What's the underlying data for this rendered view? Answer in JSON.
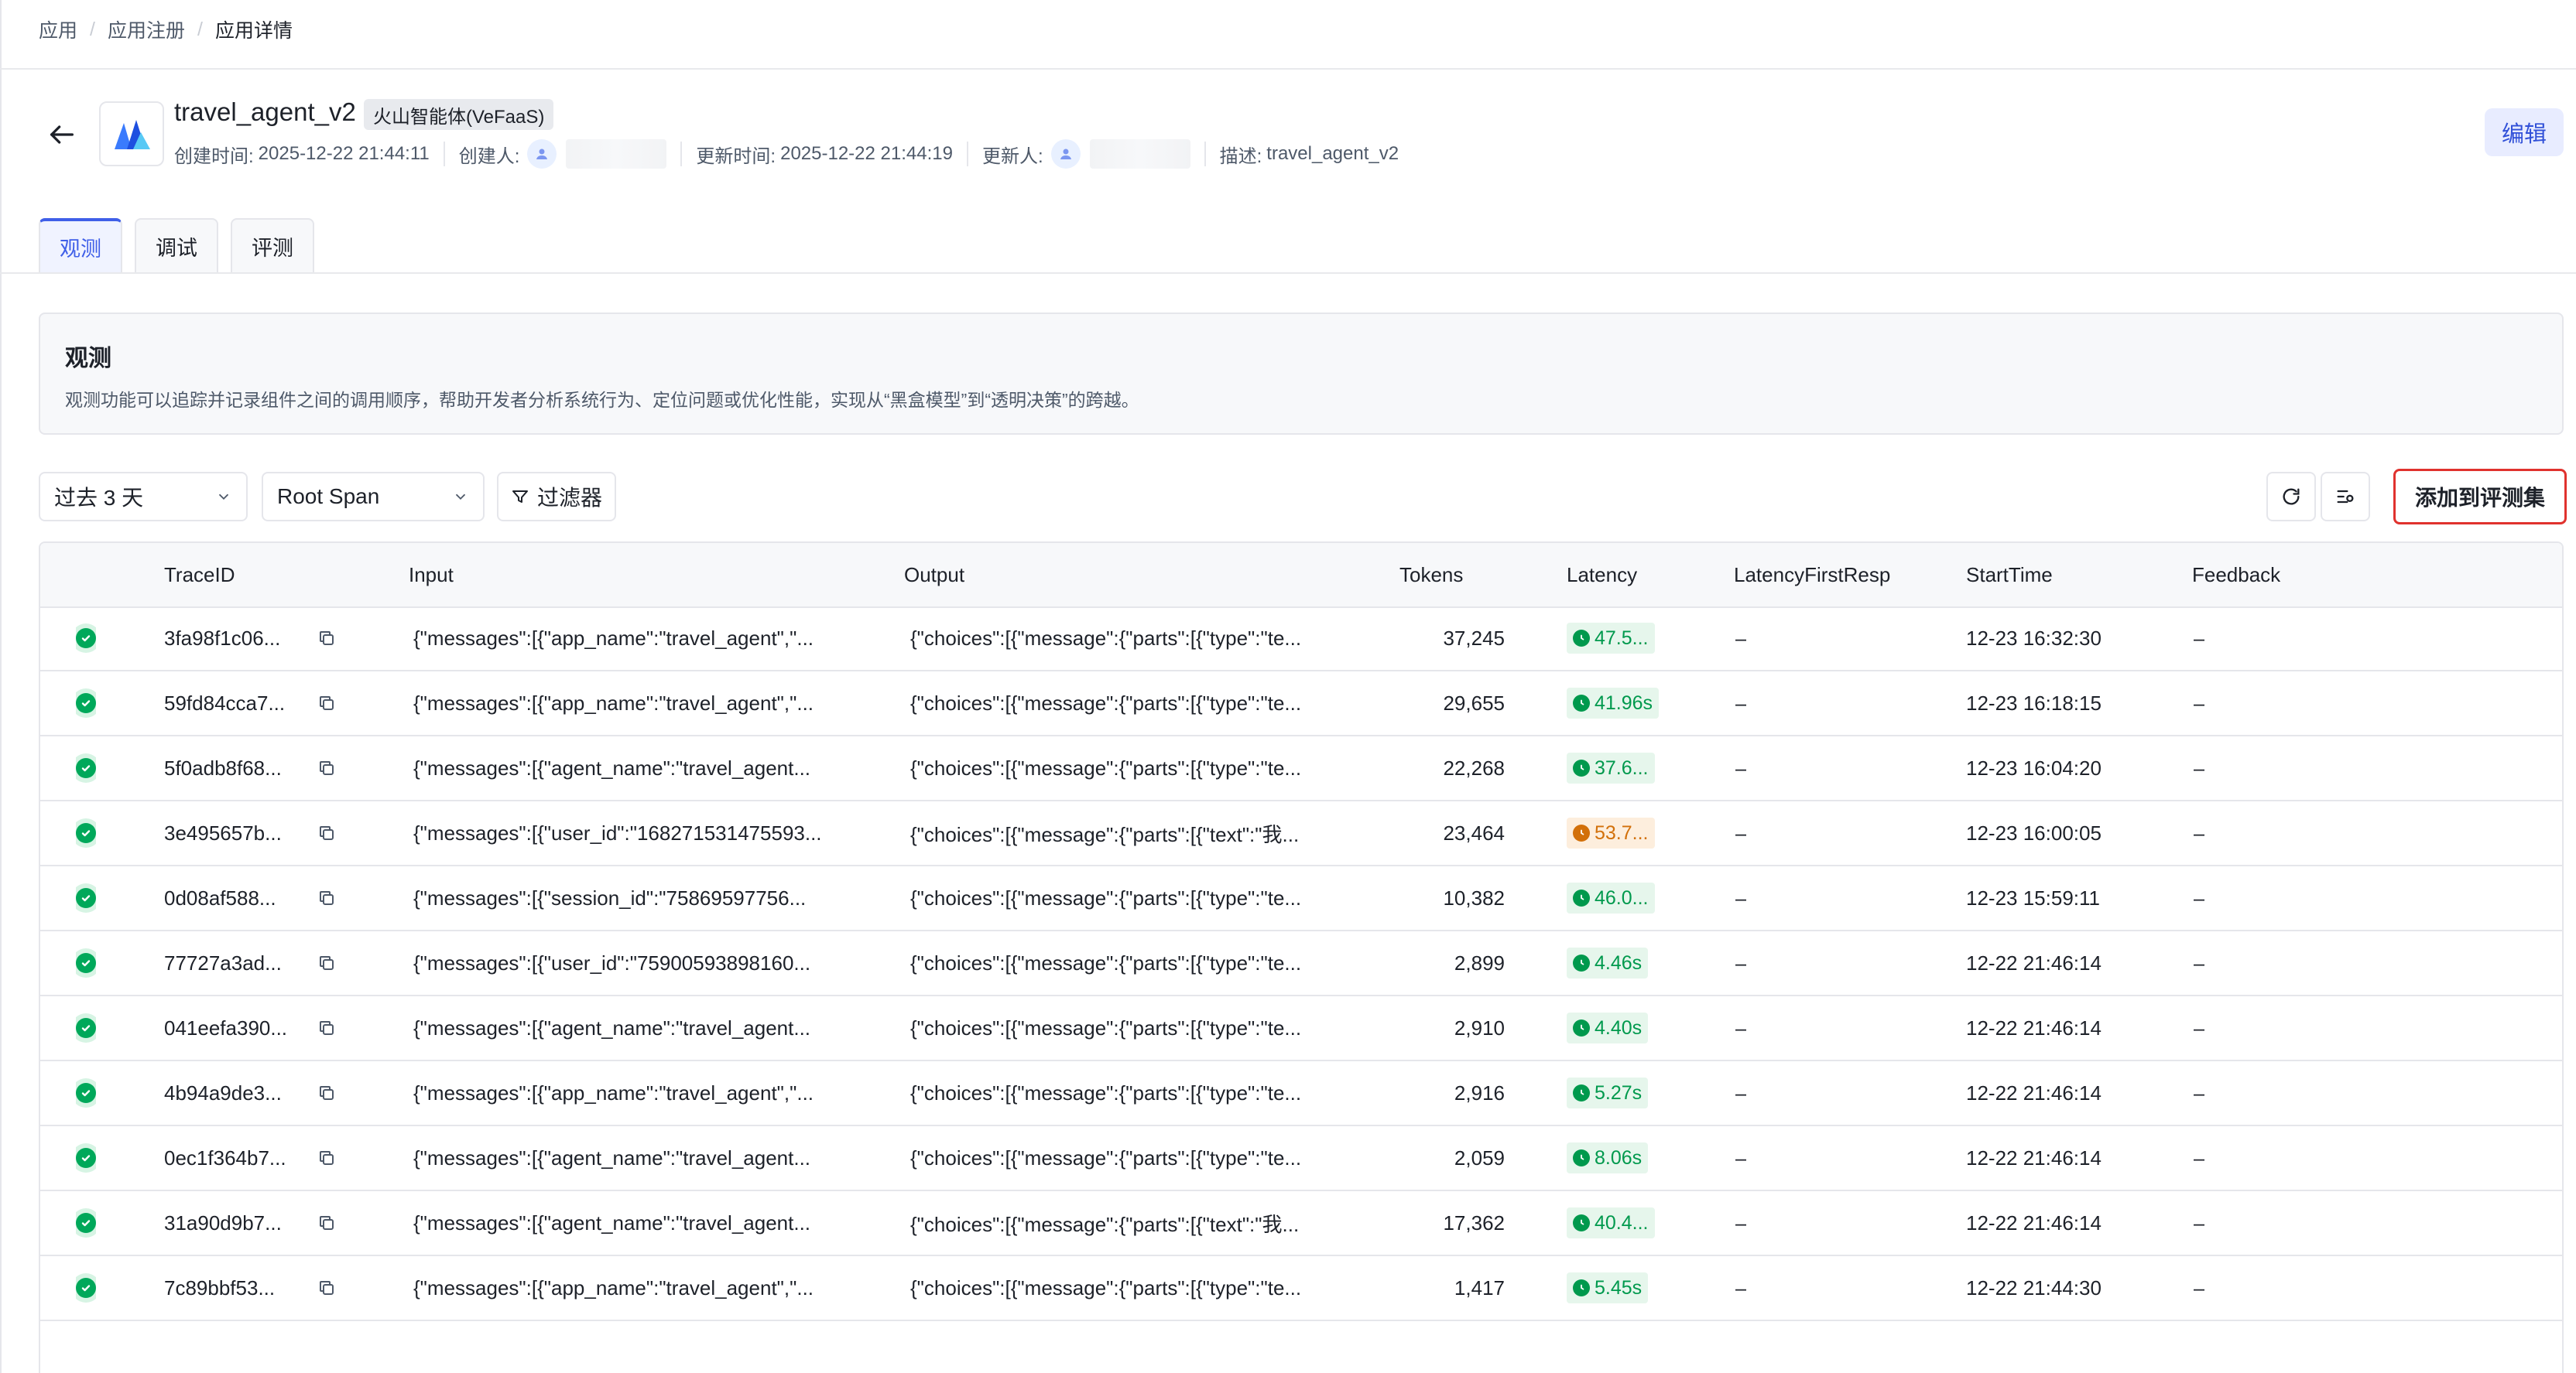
{
  "breadcrumb": {
    "items": [
      "应用",
      "应用注册"
    ],
    "current": "应用详情",
    "separator": "/"
  },
  "app": {
    "name": "travel_agent_v2",
    "tag": "火山智能体(VeFaaS)",
    "created_label": "创建时间:",
    "created_value": "2025-12-22 21:44:11",
    "creator_label": "创建人:",
    "updated_label": "更新时间:",
    "updated_value": "2025-12-22 21:44:19",
    "updater_label": "更新人:",
    "desc_label": "描述:",
    "desc_value": "travel_agent_v2",
    "edit_label": "编辑"
  },
  "tabs": [
    {
      "label": "观测",
      "active": true
    },
    {
      "label": "调试",
      "active": false
    },
    {
      "label": "评测",
      "active": false
    }
  ],
  "info": {
    "title": "观测",
    "description": "观测功能可以追踪并记录组件之间的调用顺序，帮助开发者分析系统行为、定位问题或优化性能，实现从“黑盒模型”到“透明决策”的跨越。"
  },
  "filters": {
    "time_range": "过去 3 天",
    "span_type": "Root Span",
    "filter_label": "过滤器",
    "add_to_eval_label": "添加到评测集"
  },
  "table": {
    "columns": [
      "TraceID",
      "Input",
      "Output",
      "Tokens",
      "Latency",
      "LatencyFirstResp",
      "StartTime",
      "Feedback"
    ],
    "rows": [
      {
        "trace_id": "3fa98f1c06...",
        "input": "{\"messages\":[{\"app_name\":\"travel_agent\",\"...",
        "output": "{\"choices\":[{\"message\":{\"parts\":[{\"type\":\"te...",
        "tokens": "37,245",
        "latency": "47.5...",
        "latency_level": "green",
        "first_resp": "–",
        "start_time": "12-23 16:32:30",
        "feedback": "–"
      },
      {
        "trace_id": "59fd84cca7...",
        "input": "{\"messages\":[{\"app_name\":\"travel_agent\",\"...",
        "output": "{\"choices\":[{\"message\":{\"parts\":[{\"type\":\"te...",
        "tokens": "29,655",
        "latency": "41.96s",
        "latency_level": "green",
        "first_resp": "–",
        "start_time": "12-23 16:18:15",
        "feedback": "–"
      },
      {
        "trace_id": "5f0adb8f68...",
        "input": "{\"messages\":[{\"agent_name\":\"travel_agent...",
        "output": "{\"choices\":[{\"message\":{\"parts\":[{\"type\":\"te...",
        "tokens": "22,268",
        "latency": "37.6...",
        "latency_level": "green",
        "first_resp": "–",
        "start_time": "12-23 16:04:20",
        "feedback": "–"
      },
      {
        "trace_id": "3e495657b...",
        "input": "{\"messages\":[{\"user_id\":\"168271531475593...",
        "output": "{\"choices\":[{\"message\":{\"parts\":[{\"text\":\"我...",
        "tokens": "23,464",
        "latency": "53.7...",
        "latency_level": "orange",
        "first_resp": "–",
        "start_time": "12-23 16:00:05",
        "feedback": "–"
      },
      {
        "trace_id": "0d08af588...",
        "input": "{\"messages\":[{\"session_id\":\"75869597756...",
        "output": "{\"choices\":[{\"message\":{\"parts\":[{\"type\":\"te...",
        "tokens": "10,382",
        "latency": "46.0...",
        "latency_level": "green",
        "first_resp": "–",
        "start_time": "12-23 15:59:11",
        "feedback": "–"
      },
      {
        "trace_id": "77727a3ad...",
        "input": "{\"messages\":[{\"user_id\":\"75900593898160...",
        "output": "{\"choices\":[{\"message\":{\"parts\":[{\"type\":\"te...",
        "tokens": "2,899",
        "latency": "4.46s",
        "latency_level": "green",
        "first_resp": "–",
        "start_time": "12-22 21:46:14",
        "feedback": "–"
      },
      {
        "trace_id": "041eefa390...",
        "input": "{\"messages\":[{\"agent_name\":\"travel_agent...",
        "output": "{\"choices\":[{\"message\":{\"parts\":[{\"type\":\"te...",
        "tokens": "2,910",
        "latency": "4.40s",
        "latency_level": "green",
        "first_resp": "–",
        "start_time": "12-22 21:46:14",
        "feedback": "–"
      },
      {
        "trace_id": "4b94a9de3...",
        "input": "{\"messages\":[{\"app_name\":\"travel_agent\",\"...",
        "output": "{\"choices\":[{\"message\":{\"parts\":[{\"type\":\"te...",
        "tokens": "2,916",
        "latency": "5.27s",
        "latency_level": "green",
        "first_resp": "–",
        "start_time": "12-22 21:46:14",
        "feedback": "–"
      },
      {
        "trace_id": "0ec1f364b7...",
        "input": "{\"messages\":[{\"agent_name\":\"travel_agent...",
        "output": "{\"choices\":[{\"message\":{\"parts\":[{\"type\":\"te...",
        "tokens": "2,059",
        "latency": "8.06s",
        "latency_level": "green",
        "first_resp": "–",
        "start_time": "12-22 21:46:14",
        "feedback": "–"
      },
      {
        "trace_id": "31a90d9b7...",
        "input": "{\"messages\":[{\"agent_name\":\"travel_agent...",
        "output": "{\"choices\":[{\"message\":{\"parts\":[{\"text\":\"我...",
        "tokens": "17,362",
        "latency": "40.4...",
        "latency_level": "green",
        "first_resp": "–",
        "start_time": "12-22 21:46:14",
        "feedback": "–"
      },
      {
        "trace_id": "7c89bbf53...",
        "input": "{\"messages\":[{\"app_name\":\"travel_agent\",\"...",
        "output": "{\"choices\":[{\"message\":{\"parts\":[{\"type\":\"te...",
        "tokens": "1,417",
        "latency": "5.45s",
        "latency_level": "green",
        "first_resp": "–",
        "start_time": "12-22 21:44:30",
        "feedback": "–"
      }
    ]
  },
  "colors": {
    "accent": "#3f5fe8",
    "success": "#00a85a",
    "warning": "#d2700a",
    "highlight_border": "#e0322e"
  },
  "icons": {
    "back": "arrow-left-icon",
    "copy": "copy-icon",
    "refresh": "refresh-icon",
    "settings": "column-settings-icon",
    "filter": "filter-icon"
  }
}
